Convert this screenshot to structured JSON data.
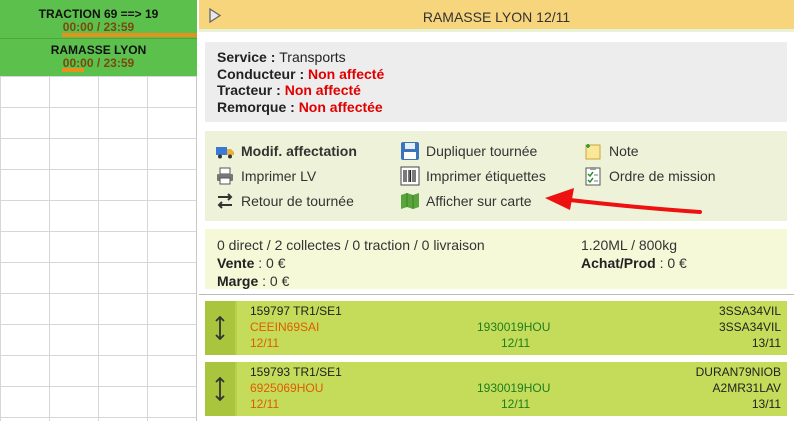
{
  "planning": {
    "trips": [
      {
        "title": "TRACTION 69 ==> 19",
        "time": "00:00 / 23:59"
      },
      {
        "title": "RAMASSE LYON",
        "time": "00:00 / 23:59"
      }
    ]
  },
  "panel": {
    "title": "RAMASSE LYON 12/11",
    "info": {
      "service_label": "Service :",
      "service_value": "Transports",
      "driver_label": "Conducteur :",
      "driver_value": "Non affecté",
      "tractor_label": "Tracteur :",
      "tractor_value": "Non affecté",
      "trailer_label": "Remorque :",
      "trailer_value": "Non affectée"
    },
    "actions": {
      "modif": "Modif. affectation",
      "print_lv": "Imprimer LV",
      "retour": "Retour de tournée",
      "dupliquer": "Dupliquer tournée",
      "etiquettes": "Imprimer étiquettes",
      "carte": "Afficher sur carte",
      "note": "Note",
      "ordre": "Ordre de mission"
    },
    "summary": {
      "counts": "0 direct / 2 collectes / 0 traction / 0 livraison",
      "capacity": "1.20ML / 800kg",
      "vente_label": "Vente",
      "vente_value": ": 0 €",
      "achat_label": "Achat/Prod",
      "achat_value": ": 0 €",
      "marge_label": "Marge",
      "marge_value": ": 0 €"
    },
    "orders": [
      {
        "id": "159797 TR1/SE1",
        "code_left": "CEEIN69SAI",
        "date_left": "12/11",
        "code_mid": "1930019HOU",
        "date_mid": "12/11",
        "code_right_1": "3SSA34VIL",
        "code_right_2": "3SSA34VIL",
        "date_right": "13/11"
      },
      {
        "id": "159793 TR1/SE1",
        "code_left": "6925069HOU",
        "date_left": "12/11",
        "code_mid": "1930019HOU",
        "date_mid": "12/11",
        "code_right_1": "DURAN79NIOB",
        "code_right_2": "A2MR31LAV",
        "date_right": "13/11"
      }
    ]
  },
  "colors": {
    "trip_bg": "#5cc04c",
    "header_bg": "#f7d57c",
    "alert_red": "#e00000",
    "card_bg": "#c4dc5a",
    "code_orange": "#e05b00",
    "code_green": "#1f7d1f"
  },
  "icons": [
    "truck-icon",
    "printer-icon",
    "swap-arrows-icon",
    "floppy-disk-icon",
    "barcode-icon",
    "map-icon",
    "note-icon",
    "checklist-icon",
    "drag-handle-icon",
    "collapse-triangle-icon"
  ]
}
